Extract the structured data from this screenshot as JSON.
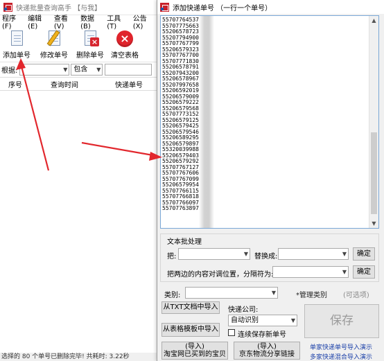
{
  "main": {
    "title": "快递批量查询高手 【与我】",
    "menu": [
      "程序(F)",
      "编辑(E)",
      "查看(V)",
      "数据(B)",
      "工具(T)",
      "公告(X)"
    ],
    "toolbar": [
      "添加单号",
      "修改单号",
      "删除单号",
      "清空表格"
    ],
    "search": {
      "label": "根据:",
      "field_value": "",
      "match_value": "包含",
      "query": ""
    },
    "columns": [
      "序号",
      "查询时间",
      "快递单号"
    ],
    "status": "选择的 80 个单号已删除完毕! 共耗时: 3.22秒"
  },
  "dialog": {
    "title": "添加快递单号 （一行一个单号）",
    "numbers": [
      "55707764537",
      "55707775663",
      "55206578723",
      "55207794900",
      "55707767799",
      "55206579323",
      "55707767700",
      "55707771830",
      "55206578791",
      "55207943200",
      "55206578967",
      "55207997658",
      "55206592019",
      "55206579009",
      "55206579222",
      "55206579568",
      "55707773152",
      "55206579125",
      "55206579425",
      "55206579546",
      "55206589295",
      "55206579897",
      "55320039988",
      "55206579403",
      "55206579292",
      "55707767127",
      "55707767606",
      "55707767099",
      "55206579954",
      "55707766115",
      "55707766818",
      "55707766097",
      "55707763897"
    ],
    "group_title": "文本批处理",
    "replace": {
      "from_label": "把:",
      "from_value": "",
      "to_label": "替换成:",
      "to_value": "",
      "ok_label": "确定"
    },
    "swap": {
      "label": "把两边的内容对调位置，分隔符为:",
      "value": "",
      "ok_label": "确定"
    },
    "category": {
      "label": "类别:",
      "value": "",
      "manage_label": "*管理类别",
      "hint": "(可选项)"
    },
    "import_txt_label": "从TXT文档中导入",
    "import_table_label": "从表格模板中导入",
    "courier": {
      "label": "快递公司:",
      "value": "自动识别"
    },
    "save_new_label": "连续保存新单号",
    "save_label": "保存",
    "import_taobao_title": "(导入)",
    "import_taobao_label": "淘宝网已买到的宝贝",
    "import_jd_title": "(导入)",
    "import_jd_label": "京东物流分享链接",
    "links": [
      "单家快递单号导入演示",
      "多家快递混合导入演示"
    ]
  },
  "colors": {
    "arrow": "#e2272d",
    "link": "#1a3fa8",
    "textarea_border": "#7aa7d6"
  }
}
